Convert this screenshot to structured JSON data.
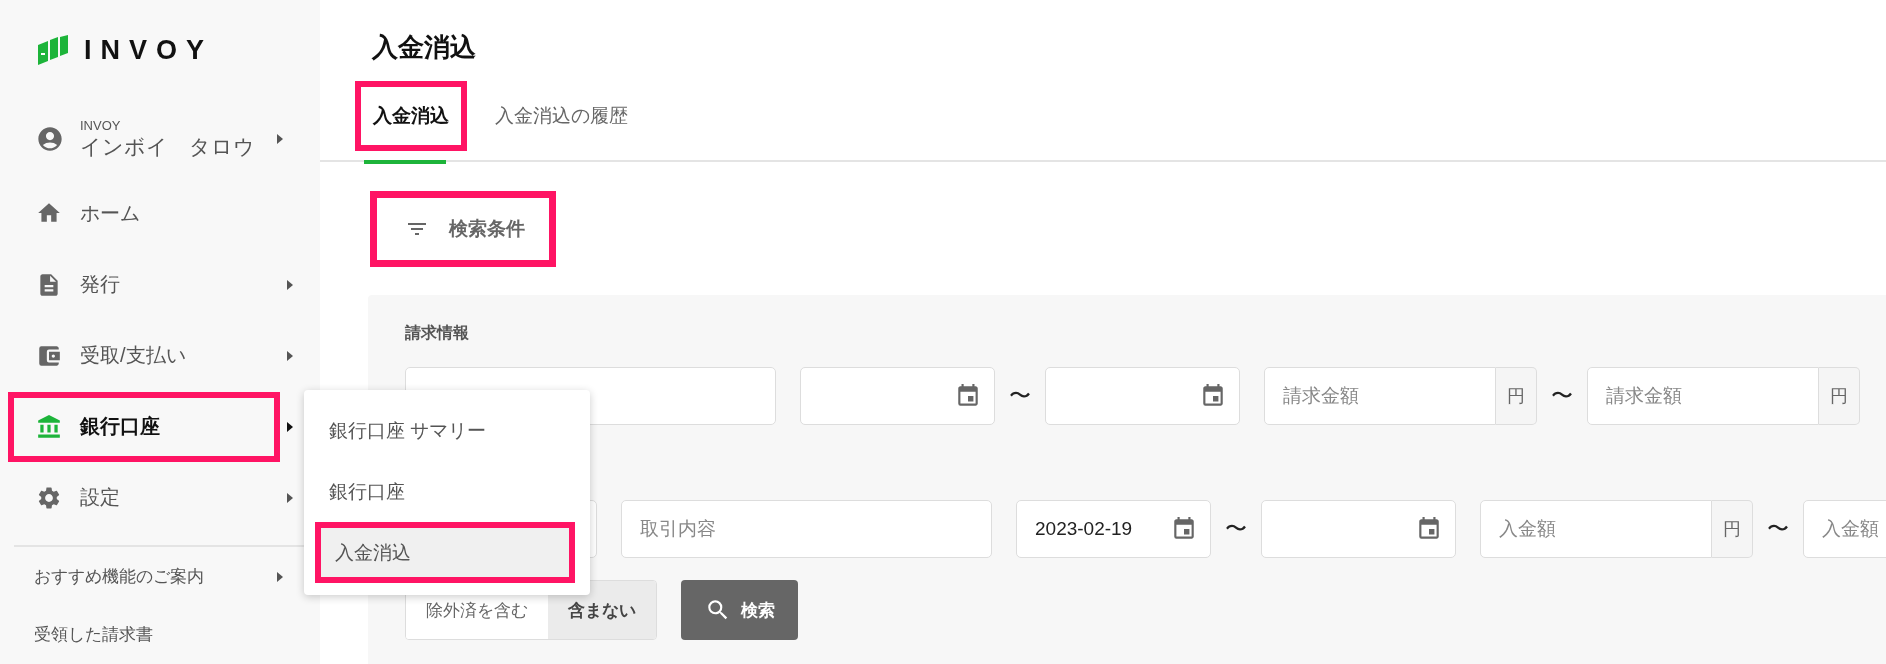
{
  "logo": {
    "text": "INVOY"
  },
  "account": {
    "company": "INVOY",
    "name": "インボイ　タロウ",
    "has_submenu": true
  },
  "nav": [
    {
      "label": "ホーム",
      "has_submenu": false,
      "active": false,
      "highlighted": false
    },
    {
      "label": "発行",
      "has_submenu": true,
      "active": false,
      "highlighted": false
    },
    {
      "label": "受取/支払い",
      "has_submenu": true,
      "active": false,
      "highlighted": false
    },
    {
      "label": "銀行口座",
      "has_submenu": true,
      "active": true,
      "highlighted": true
    },
    {
      "label": "設定",
      "has_submenu": true,
      "active": false,
      "highlighted": false
    }
  ],
  "secondary_nav": [
    {
      "label": "おすすめ機能のご案内",
      "has_submenu": true
    },
    {
      "label": "受領した請求書",
      "has_submenu": false
    }
  ],
  "page_title": "入金消込",
  "tabs": [
    {
      "label": "入金消込",
      "selected": true,
      "highlighted": true
    },
    {
      "label": "入金消込の履歴",
      "selected": false,
      "highlighted": false
    }
  ],
  "filter_button": {
    "label": "検索条件",
    "highlighted": true
  },
  "search_panel": {
    "section_label": "請求情報",
    "rows": [
      [
        {
          "kind": "text"
        },
        {
          "kind": "date"
        },
        {
          "kind": "separator",
          "text": "〜"
        },
        {
          "kind": "date"
        },
        {
          "kind": "amount",
          "placeholder": "請求金額",
          "unit": "円"
        },
        {
          "kind": "separator",
          "text": "〜"
        },
        {
          "kind": "amount",
          "placeholder": "請求金額",
          "unit": "円"
        }
      ],
      [
        {
          "kind": "text"
        },
        {
          "kind": "text",
          "placeholder": "取引内容"
        },
        {
          "kind": "date",
          "value": "2023-02-19"
        },
        {
          "kind": "separator",
          "text": "〜"
        },
        {
          "kind": "date"
        },
        {
          "kind": "amount",
          "placeholder": "入金額",
          "unit": "円"
        },
        {
          "kind": "separator",
          "text": "〜"
        },
        {
          "kind": "amount",
          "placeholder": "入金額"
        }
      ]
    ],
    "toggle": [
      {
        "label": "除外済を含む",
        "selected": false
      },
      {
        "label": "含まない",
        "selected": true
      }
    ],
    "search_button": {
      "label": "検索"
    }
  },
  "menu": {
    "items": [
      {
        "label": "銀行口座 サマリー",
        "selected": false,
        "highlighted": false
      },
      {
        "label": "銀行口座",
        "selected": false,
        "highlighted": false
      },
      {
        "label": "入金消込",
        "selected": true,
        "highlighted": true
      }
    ]
  }
}
